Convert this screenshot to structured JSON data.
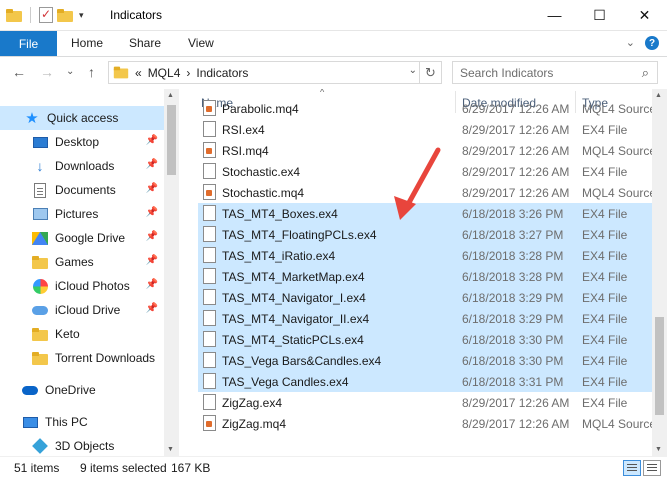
{
  "window": {
    "title": "Indicators",
    "controls": {
      "minimize": "—",
      "maximize": "☐",
      "close": "✕"
    }
  },
  "ribbon": {
    "tabs": [
      "File",
      "Home",
      "Share",
      "View"
    ],
    "collapse_glyph": "⌄",
    "help_glyph": "?"
  },
  "nav_buttons": {
    "back": "←",
    "forward": "→",
    "recent": "⌄",
    "up": "↑"
  },
  "address": {
    "overflow": "«",
    "segments": [
      "MQL4",
      "Indicators"
    ],
    "separator": "›",
    "dropdown_glyph": "⌄",
    "refresh_glyph": "↻"
  },
  "search": {
    "placeholder": "Search Indicators",
    "icon": "magnifier-icon",
    "glyph": "⌕"
  },
  "nav_pane": {
    "pin_glyph": "📌",
    "items": [
      {
        "label": "Quick access",
        "icon": "star-icon",
        "glyph": "★",
        "active": true,
        "pinned": false
      },
      {
        "label": "Desktop",
        "icon": "desktop-icon",
        "pinned": true
      },
      {
        "label": "Downloads",
        "icon": "download-icon",
        "glyph": "↓",
        "pinned": true
      },
      {
        "label": "Documents",
        "icon": "document-icon",
        "pinned": true
      },
      {
        "label": "Pictures",
        "icon": "pictures-icon",
        "pinned": true
      },
      {
        "label": "Google Drive",
        "icon": "google-drive-icon",
        "pinned": true
      },
      {
        "label": "Games",
        "icon": "folder-icon",
        "pinned": true
      },
      {
        "label": "iCloud Photos",
        "icon": "icloud-photos-icon",
        "pinned": true
      },
      {
        "label": "iCloud Drive",
        "icon": "icloud-drive-icon",
        "pinned": true
      },
      {
        "label": "Keto",
        "icon": "folder-icon",
        "pinned": false
      },
      {
        "label": "Torrent Downloads",
        "icon": "folder-icon",
        "pinned": false
      },
      {
        "label": "OneDrive",
        "icon": "onedrive-icon",
        "pinned": false
      },
      {
        "label": "This PC",
        "icon": "this-pc-icon",
        "pinned": false
      },
      {
        "label": "3D Objects",
        "icon": "3d-objects-icon",
        "pinned": false
      }
    ]
  },
  "columns": {
    "name": "Name",
    "date": "Date modified",
    "type": "Type",
    "sort_glyph": "^"
  },
  "files": [
    {
      "name": "Parabolic.mq4",
      "date": "6/29/2017 12:26 AM",
      "type": "MQL4 Source",
      "kind": "mq",
      "selected": false
    },
    {
      "name": "RSI.ex4",
      "date": "8/29/2017 12:26 AM",
      "type": "EX4 File",
      "kind": "ex",
      "selected": false
    },
    {
      "name": "RSI.mq4",
      "date": "8/29/2017 12:26 AM",
      "type": "MQL4 Source",
      "kind": "mq",
      "selected": false
    },
    {
      "name": "Stochastic.ex4",
      "date": "8/29/2017 12:26 AM",
      "type": "EX4 File",
      "kind": "ex",
      "selected": false
    },
    {
      "name": "Stochastic.mq4",
      "date": "8/29/2017 12:26 AM",
      "type": "MQL4 Source",
      "kind": "mq",
      "selected": false
    },
    {
      "name": "TAS_MT4_Boxes.ex4",
      "date": "6/18/2018 3:26 PM",
      "type": "EX4 File",
      "kind": "ex",
      "selected": true
    },
    {
      "name": "TAS_MT4_FloatingPCLs.ex4",
      "date": "6/18/2018 3:27 PM",
      "type": "EX4 File",
      "kind": "ex",
      "selected": true
    },
    {
      "name": "TAS_MT4_iRatio.ex4",
      "date": "6/18/2018 3:28 PM",
      "type": "EX4 File",
      "kind": "ex",
      "selected": true
    },
    {
      "name": "TAS_MT4_MarketMap.ex4",
      "date": "6/18/2018 3:28 PM",
      "type": "EX4 File",
      "kind": "ex",
      "selected": true
    },
    {
      "name": "TAS_MT4_Navigator_I.ex4",
      "date": "6/18/2018 3:29 PM",
      "type": "EX4 File",
      "kind": "ex",
      "selected": true
    },
    {
      "name": "TAS_MT4_Navigator_II.ex4",
      "date": "6/18/2018 3:29 PM",
      "type": "EX4 File",
      "kind": "ex",
      "selected": true
    },
    {
      "name": "TAS_MT4_StaticPCLs.ex4",
      "date": "6/18/2018 3:30 PM",
      "type": "EX4 File",
      "kind": "ex",
      "selected": true
    },
    {
      "name": "TAS_Vega Bars&Candles.ex4",
      "date": "6/18/2018 3:30 PM",
      "type": "EX4 File",
      "kind": "ex",
      "selected": true
    },
    {
      "name": "TAS_Vega Candles.ex4",
      "date": "6/18/2018 3:31 PM",
      "type": "EX4 File",
      "kind": "ex",
      "selected": true
    },
    {
      "name": "ZigZag.ex4",
      "date": "8/29/2017 12:26 AM",
      "type": "EX4 File",
      "kind": "ex",
      "selected": false
    },
    {
      "name": "ZigZag.mq4",
      "date": "8/29/2017 12:26 AM",
      "type": "MQL4 Source",
      "kind": "mq",
      "selected": false
    }
  ],
  "status": {
    "count": "51 items",
    "selected": "9 items selected",
    "size": "167 KB"
  },
  "colors": {
    "accent": "#1979ca",
    "selection": "#cce8ff",
    "arrow": "#e8453c"
  }
}
